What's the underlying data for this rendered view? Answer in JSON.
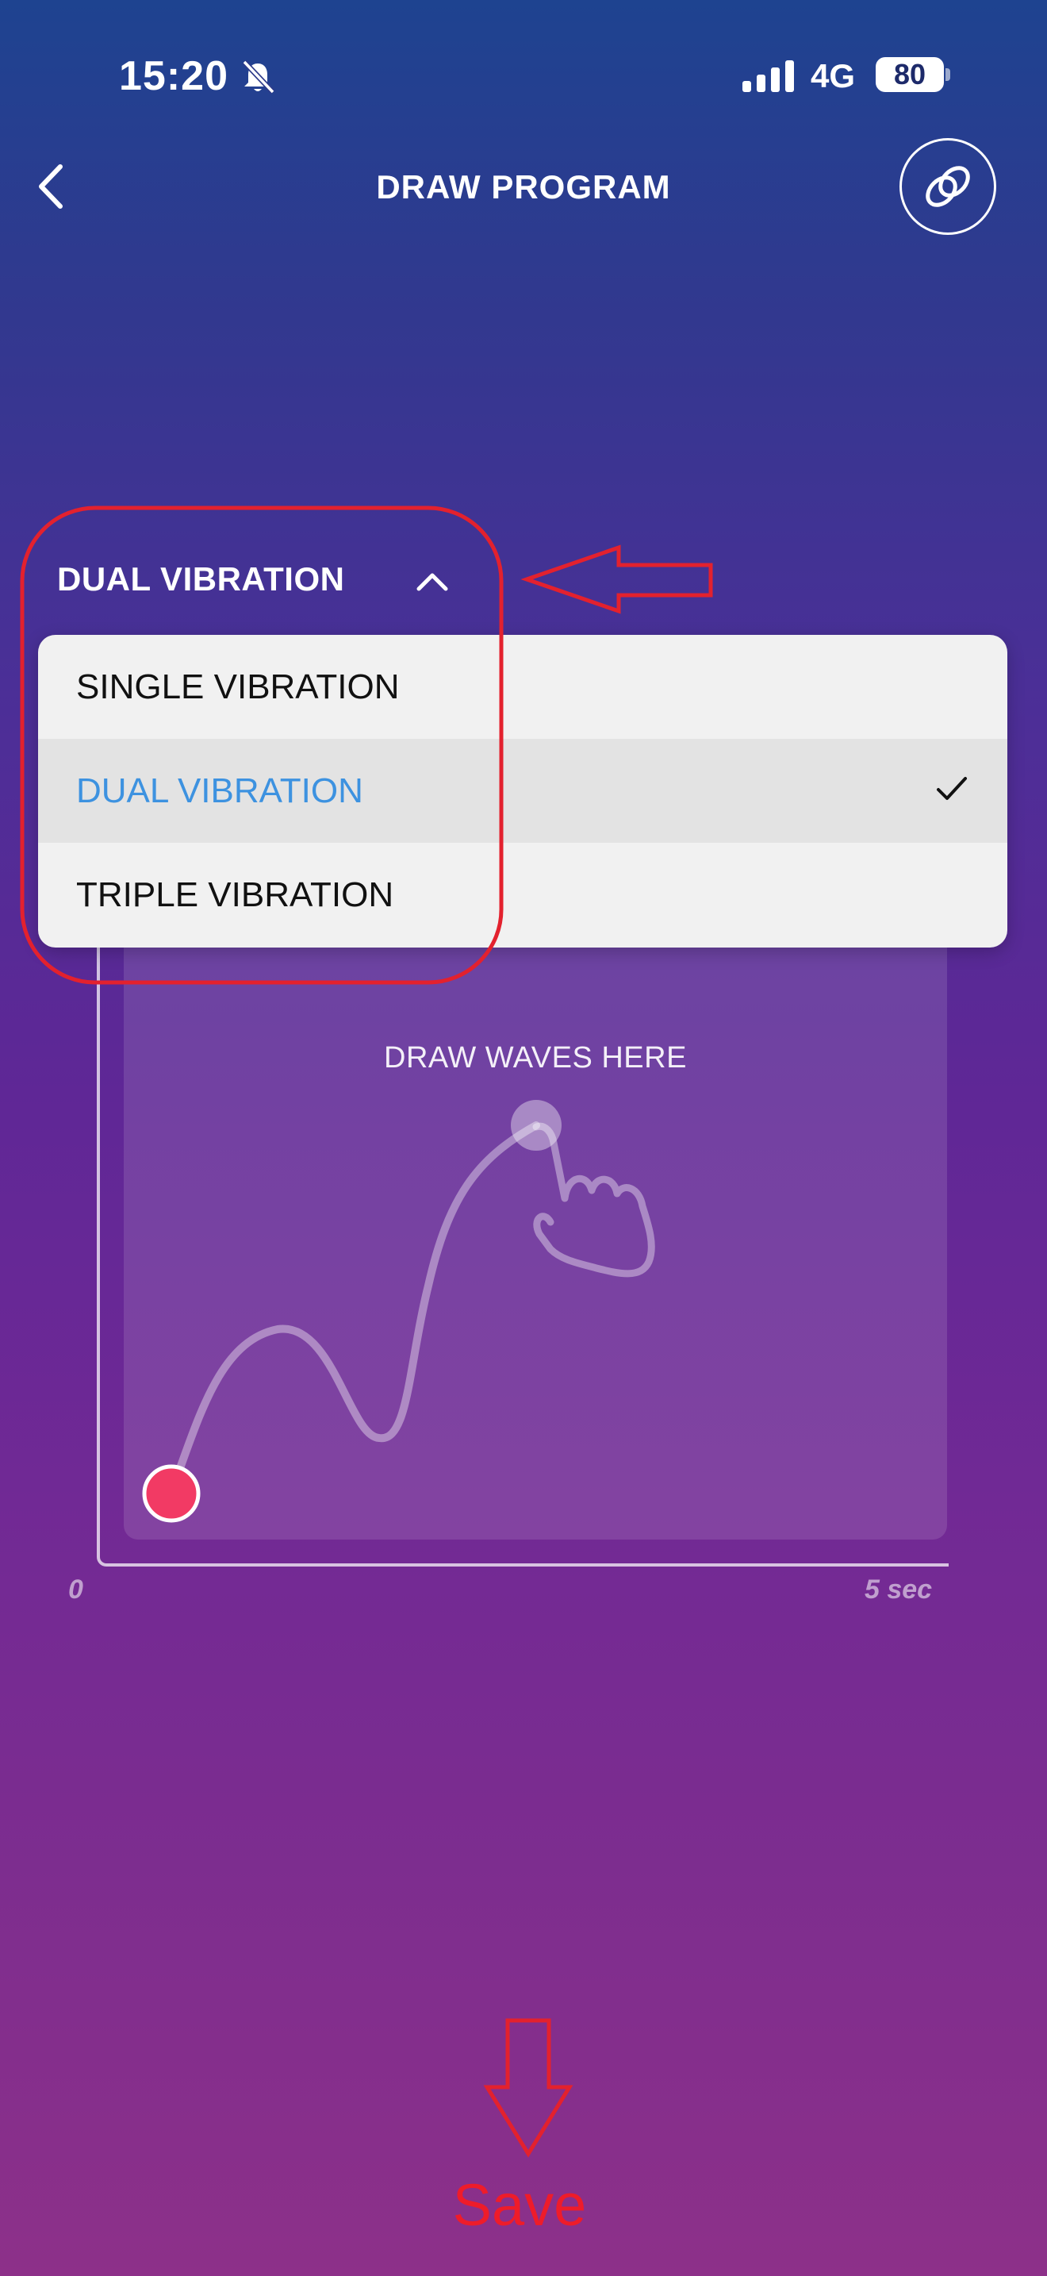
{
  "status_bar": {
    "time": "15:20",
    "network": "4G",
    "battery": "80",
    "icons": [
      "bell-muted-icon",
      "signal-icon",
      "battery-icon"
    ]
  },
  "header": {
    "title": "DRAW PROGRAM",
    "back_icon": "chevron-left-icon",
    "link_icon": "linked-rings-icon"
  },
  "vibration_selector": {
    "current": "DUAL VIBRATION",
    "caret_icon": "chevron-up-icon",
    "options": [
      {
        "label": "SINGLE VIBRATION",
        "selected": false
      },
      {
        "label": "DUAL VIBRATION",
        "selected": true
      },
      {
        "label": "TRIPLE VIBRATION",
        "selected": false
      }
    ],
    "check_icon": "checkmark-icon"
  },
  "draw_area": {
    "hint": "DRAW WAVES HERE",
    "hand_icon": "hand-pointer-icon",
    "axis_start": "0",
    "axis_end": "5 sec"
  },
  "annotations": {
    "save_label": "Save",
    "color": "#ee1c2a"
  },
  "colors": {
    "selected_option": "#3d92e0",
    "start_dot": "#f23a64"
  }
}
